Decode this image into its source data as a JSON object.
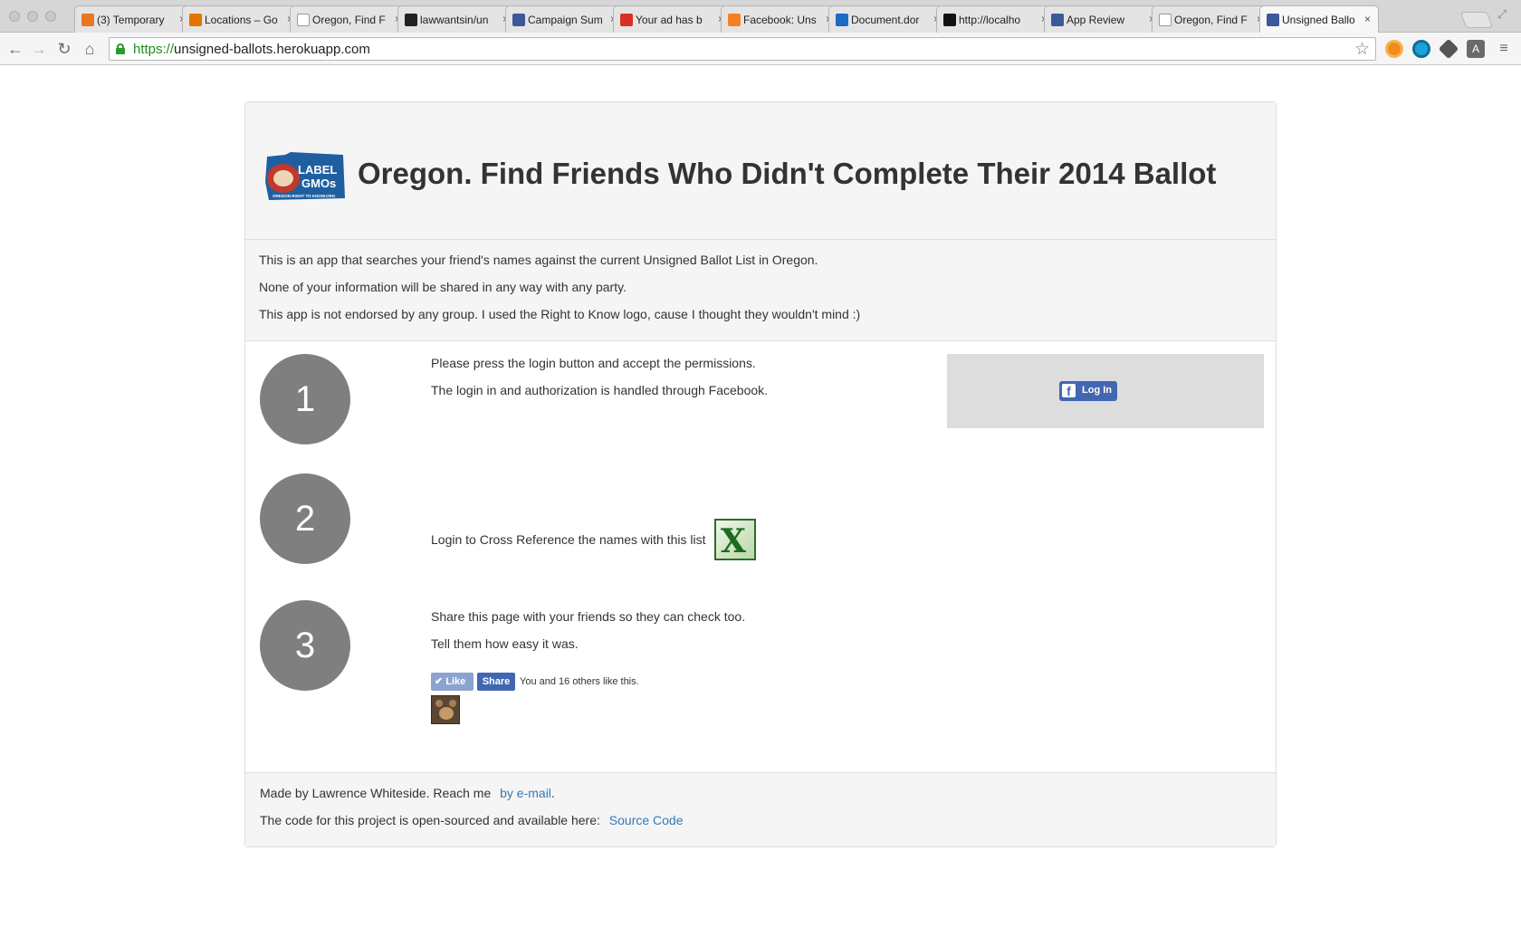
{
  "browser": {
    "tabs": [
      {
        "label": "(3) Temporary",
        "favicon": "trello-icon",
        "color": "#e87722"
      },
      {
        "label": "Locations – Go",
        "favicon": "analytics-icon",
        "color": "#e37400"
      },
      {
        "label": "Oregon, Find F",
        "favicon": "page-icon",
        "color": "#ffffff"
      },
      {
        "label": "lawwantsin/un",
        "favicon": "github-icon",
        "color": "#222222"
      },
      {
        "label": "Campaign Sum",
        "favicon": "facebook-icon",
        "color": "#3b5998"
      },
      {
        "label": "Your ad has b",
        "favicon": "gmail-icon",
        "color": "#d93025"
      },
      {
        "label": "Facebook: Uns",
        "favicon": "stackoverflow-icon",
        "color": "#f48024"
      },
      {
        "label": "Document.dor",
        "favicon": "mdn-icon",
        "color": "#1b6ac6"
      },
      {
        "label": "http://localho",
        "favicon": "node-icon",
        "color": "#111111"
      },
      {
        "label": "App Review",
        "favicon": "facebook-icon",
        "color": "#3b5998"
      },
      {
        "label": "Oregon, Find F",
        "favicon": "page-icon",
        "color": "#ffffff"
      },
      {
        "label": "Unsigned Ballo",
        "favicon": "facebook-icon",
        "color": "#3b5998"
      }
    ],
    "url_scheme": "https://",
    "url_rest": "unsigned-ballots.herokuapp.com"
  },
  "page": {
    "logo_text": "LABEL GMOs",
    "logo_subtext": "OREGON RIGHT TO KNOW.ORG",
    "title": "Oregon. Find Friends Who Didn't Complete Their 2014 Ballot",
    "intro": [
      "This is an app that searches your friend's names against the current Unsigned Ballot List in Oregon.",
      "None of your information will be shared in any way with any party.",
      "This app is not endorsed by any group. I used the Right to Know logo, cause I thought they wouldn't mind :)"
    ],
    "steps": [
      {
        "number": "1",
        "lines": [
          "Please press the login button and accept the permissions.",
          "The login in and authorization is handled through Facebook."
        ]
      },
      {
        "number": "2",
        "lines": [
          "Login to Cross Reference the names with this list"
        ]
      },
      {
        "number": "3",
        "lines": [
          "Share this page with your friends so they can check too.",
          "Tell them how easy it was."
        ]
      }
    ],
    "login_button": "Log In",
    "like_button": "Like",
    "share_button": "Share",
    "like_count_text": "You and 16 others like this.",
    "footer": {
      "made_by": "Made by Lawrence Whiteside. Reach me",
      "email_link": "by e-mail",
      "email_suffix": ".",
      "code_text": "The code for this project is open-sourced and available here:",
      "code_link": "Source Code"
    }
  }
}
